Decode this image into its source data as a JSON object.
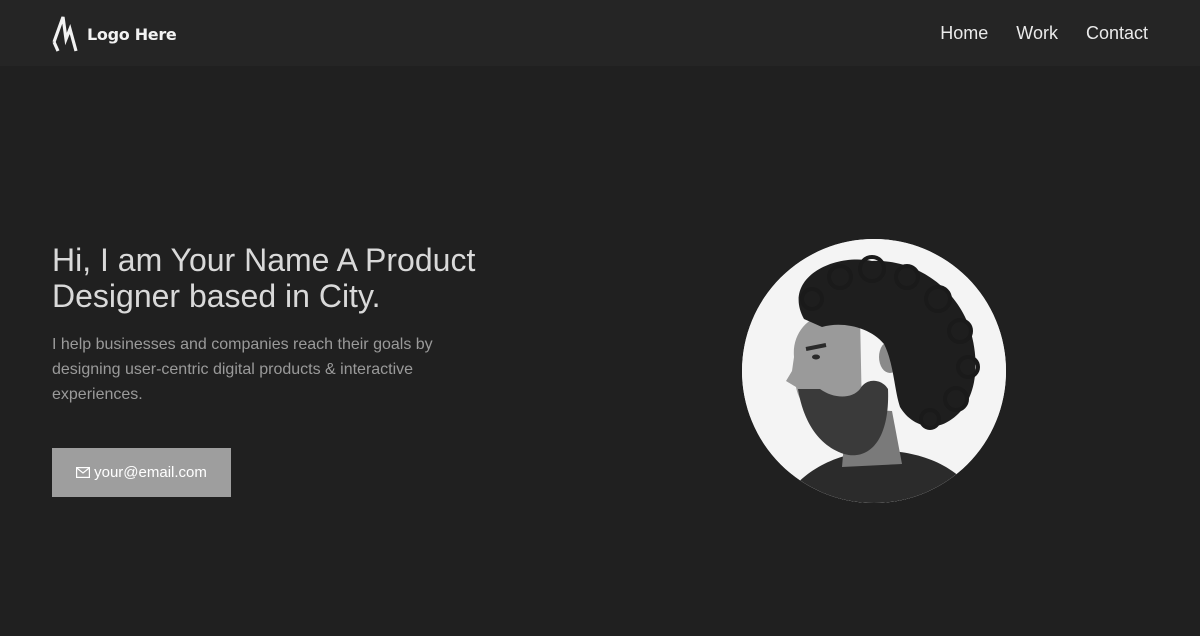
{
  "header": {
    "logo_text": "Logo Here",
    "logo_icon": "zigzag-logo-icon",
    "nav": [
      {
        "label": "Home"
      },
      {
        "label": "Work"
      },
      {
        "label": "Contact"
      }
    ]
  },
  "hero": {
    "title": "Hi, I am Your Name A Product Designer based in City.",
    "subtitle": "I help businesses and companies reach their goals by designing user-centric digital products & interactive experiences.",
    "email_button": {
      "icon": "envelope-icon",
      "label": "your@email.com"
    },
    "portrait": {
      "description_icon": "profile-photo"
    }
  },
  "colors": {
    "background": "#202020",
    "header_background": "#252525",
    "button_background": "#9e9e9e",
    "title_text": "#d9d9d9",
    "body_text": "#9a9a9a"
  }
}
